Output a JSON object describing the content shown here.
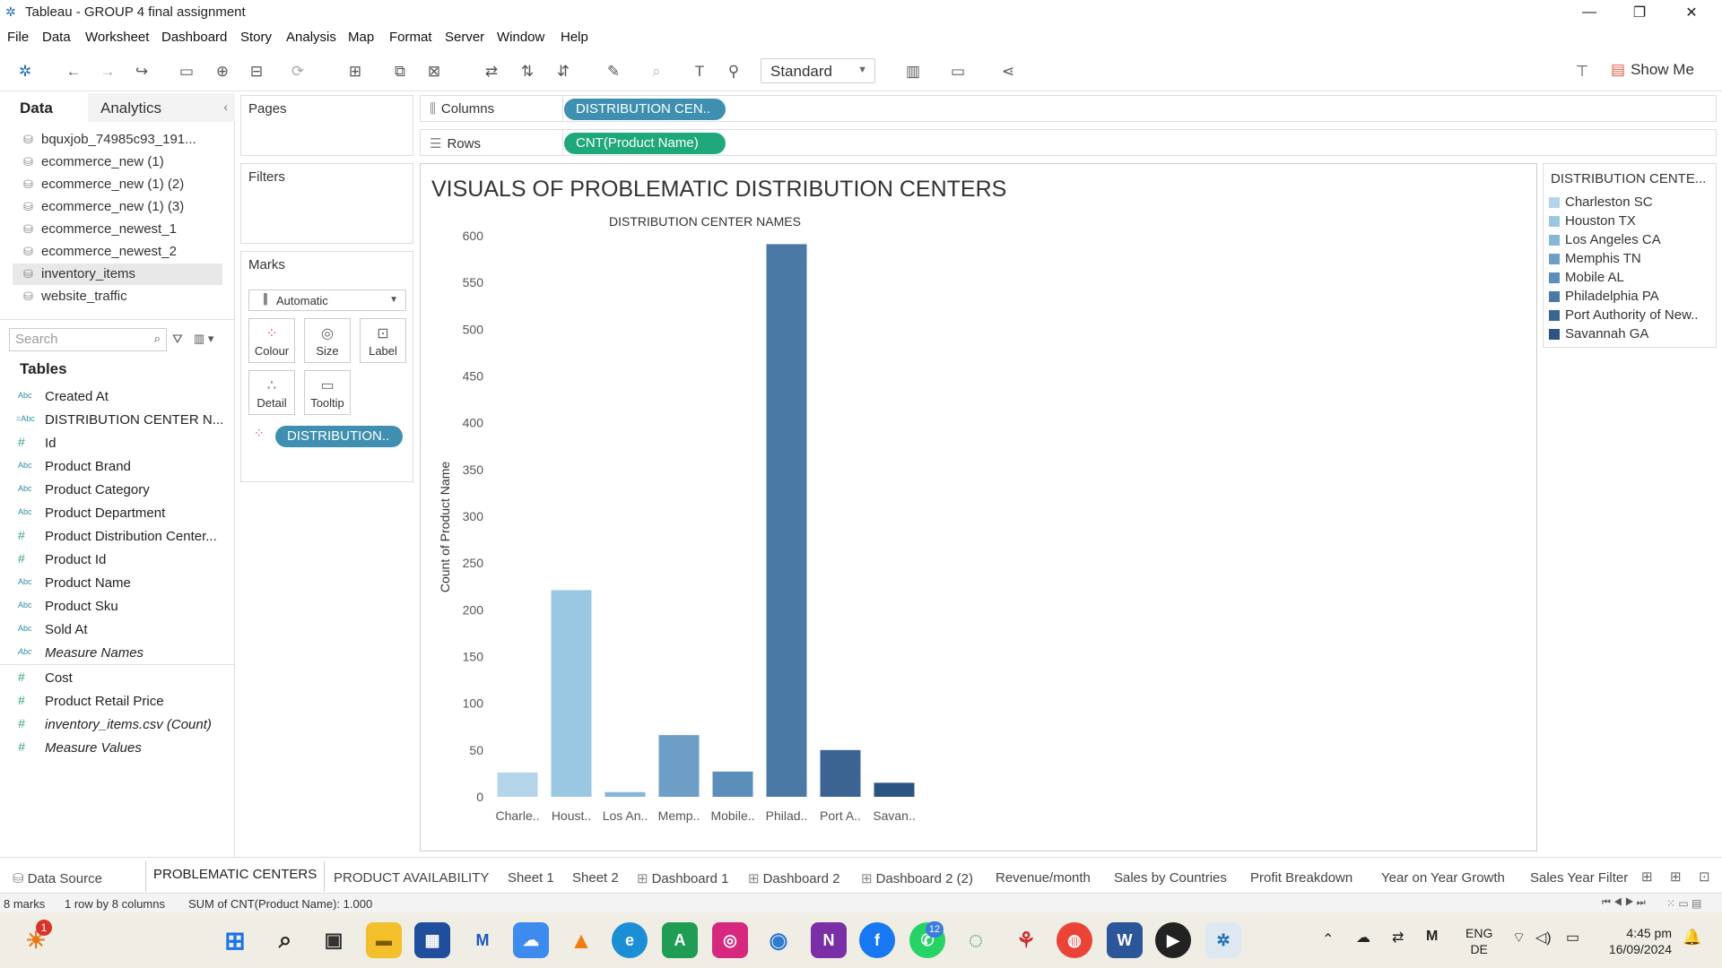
{
  "window": {
    "title": "Tableau - GROUP 4 final assignment"
  },
  "menu": [
    "File",
    "Data",
    "Worksheet",
    "Dashboard",
    "Story",
    "Analysis",
    "Map",
    "Format",
    "Server",
    "Window",
    "Help"
  ],
  "toolbar": {
    "fit_select": "Standard",
    "show_me": "Show Me"
  },
  "data_pane": {
    "tab_data": "Data",
    "tab_analytics": "Analytics",
    "sources": [
      "bquxjob_74985c93_191...",
      "ecommerce_new (1)",
      "ecommerce_new (1) (2)",
      "ecommerce_new (1) (3)",
      "ecommerce_newest_1",
      "ecommerce_newest_2",
      "inventory_items",
      "website_traffic"
    ],
    "search_placeholder": "Search",
    "tables_label": "Tables",
    "dimensions": [
      "Created At",
      "DISTRIBUTION CENTER N...",
      "Id",
      "Product Brand",
      "Product Category",
      "Product Department",
      "Product Distribution Center...",
      "Product Id",
      "Product Name",
      "Product Sku",
      "Sold At",
      "Measure Names"
    ],
    "measures": [
      "Cost",
      "Product Retail Price",
      "inventory_items.csv (Count)",
      "Measure Values"
    ]
  },
  "cards": {
    "pages": "Pages",
    "filters": "Filters",
    "marks": "Marks",
    "mark_type": "Automatic",
    "buttons": [
      "Colour",
      "Size",
      "Label",
      "Detail",
      "Tooltip"
    ],
    "color_pill": "DISTRIBUTION.."
  },
  "shelves": {
    "columns_label": "Columns",
    "columns_pill": "DISTRIBUTION CEN..",
    "rows_label": "Rows",
    "rows_pill": "CNT(Product Name)"
  },
  "view": {
    "sheet_title": "VISUALS OF PROBLEMATIC DISTRIBUTION CENTERS"
  },
  "chart_data": {
    "type": "bar",
    "title": "DISTRIBUTION CENTER NAMES",
    "xlabel": "",
    "ylabel": "Count of Product Name",
    "categories": [
      "Charle..",
      "Houst..",
      "Los An..",
      "Memp..",
      "Mobile..",
      "Philad..",
      "Port A..",
      "Savan.."
    ],
    "values": [
      26,
      221,
      5,
      66,
      27,
      591,
      50,
      15
    ],
    "ylim": [
      0,
      600
    ],
    "yticks": [
      0,
      50,
      100,
      150,
      200,
      250,
      300,
      350,
      400,
      450,
      500,
      550,
      600
    ],
    "colors": [
      "#b4d4ea",
      "#9ac8e2",
      "#86b7d6",
      "#6d9fc6",
      "#5b8ebb",
      "#4a79a6",
      "#3b6492",
      "#2c5480"
    ],
    "grid": false,
    "legend": {
      "title": "DISTRIBUTION CENTE...",
      "placement": "right",
      "entries": [
        "Charleston SC",
        "Houston TX",
        "Los Angeles CA",
        "Memphis TN",
        "Mobile AL",
        "Philadelphia PA",
        "Port Authority of New..",
        "Savannah GA"
      ]
    }
  },
  "sheet_tabs": [
    "Data Source",
    "PROBLEMATIC CENTERS",
    "PRODUCT AVAILABILITY",
    "Sheet 1",
    "Sheet 2",
    "Dashboard 1",
    "Dashboard 2",
    "Dashboard 2 (2)",
    "Revenue/month",
    "Sales by Countries",
    "Profit Breakdown",
    "Year on Year Growth",
    "Sales Year Filter"
  ],
  "status": {
    "marks": "8 marks",
    "dims": "1 row by 8 columns",
    "sum": "SUM of CNT(Product Name): 1.000"
  },
  "taskbar": {
    "lang1": "ENG",
    "lang2": "DE",
    "time": "4:45 pm",
    "date": "16/09/2024",
    "badge_1": "1",
    "badge_12": "12"
  }
}
